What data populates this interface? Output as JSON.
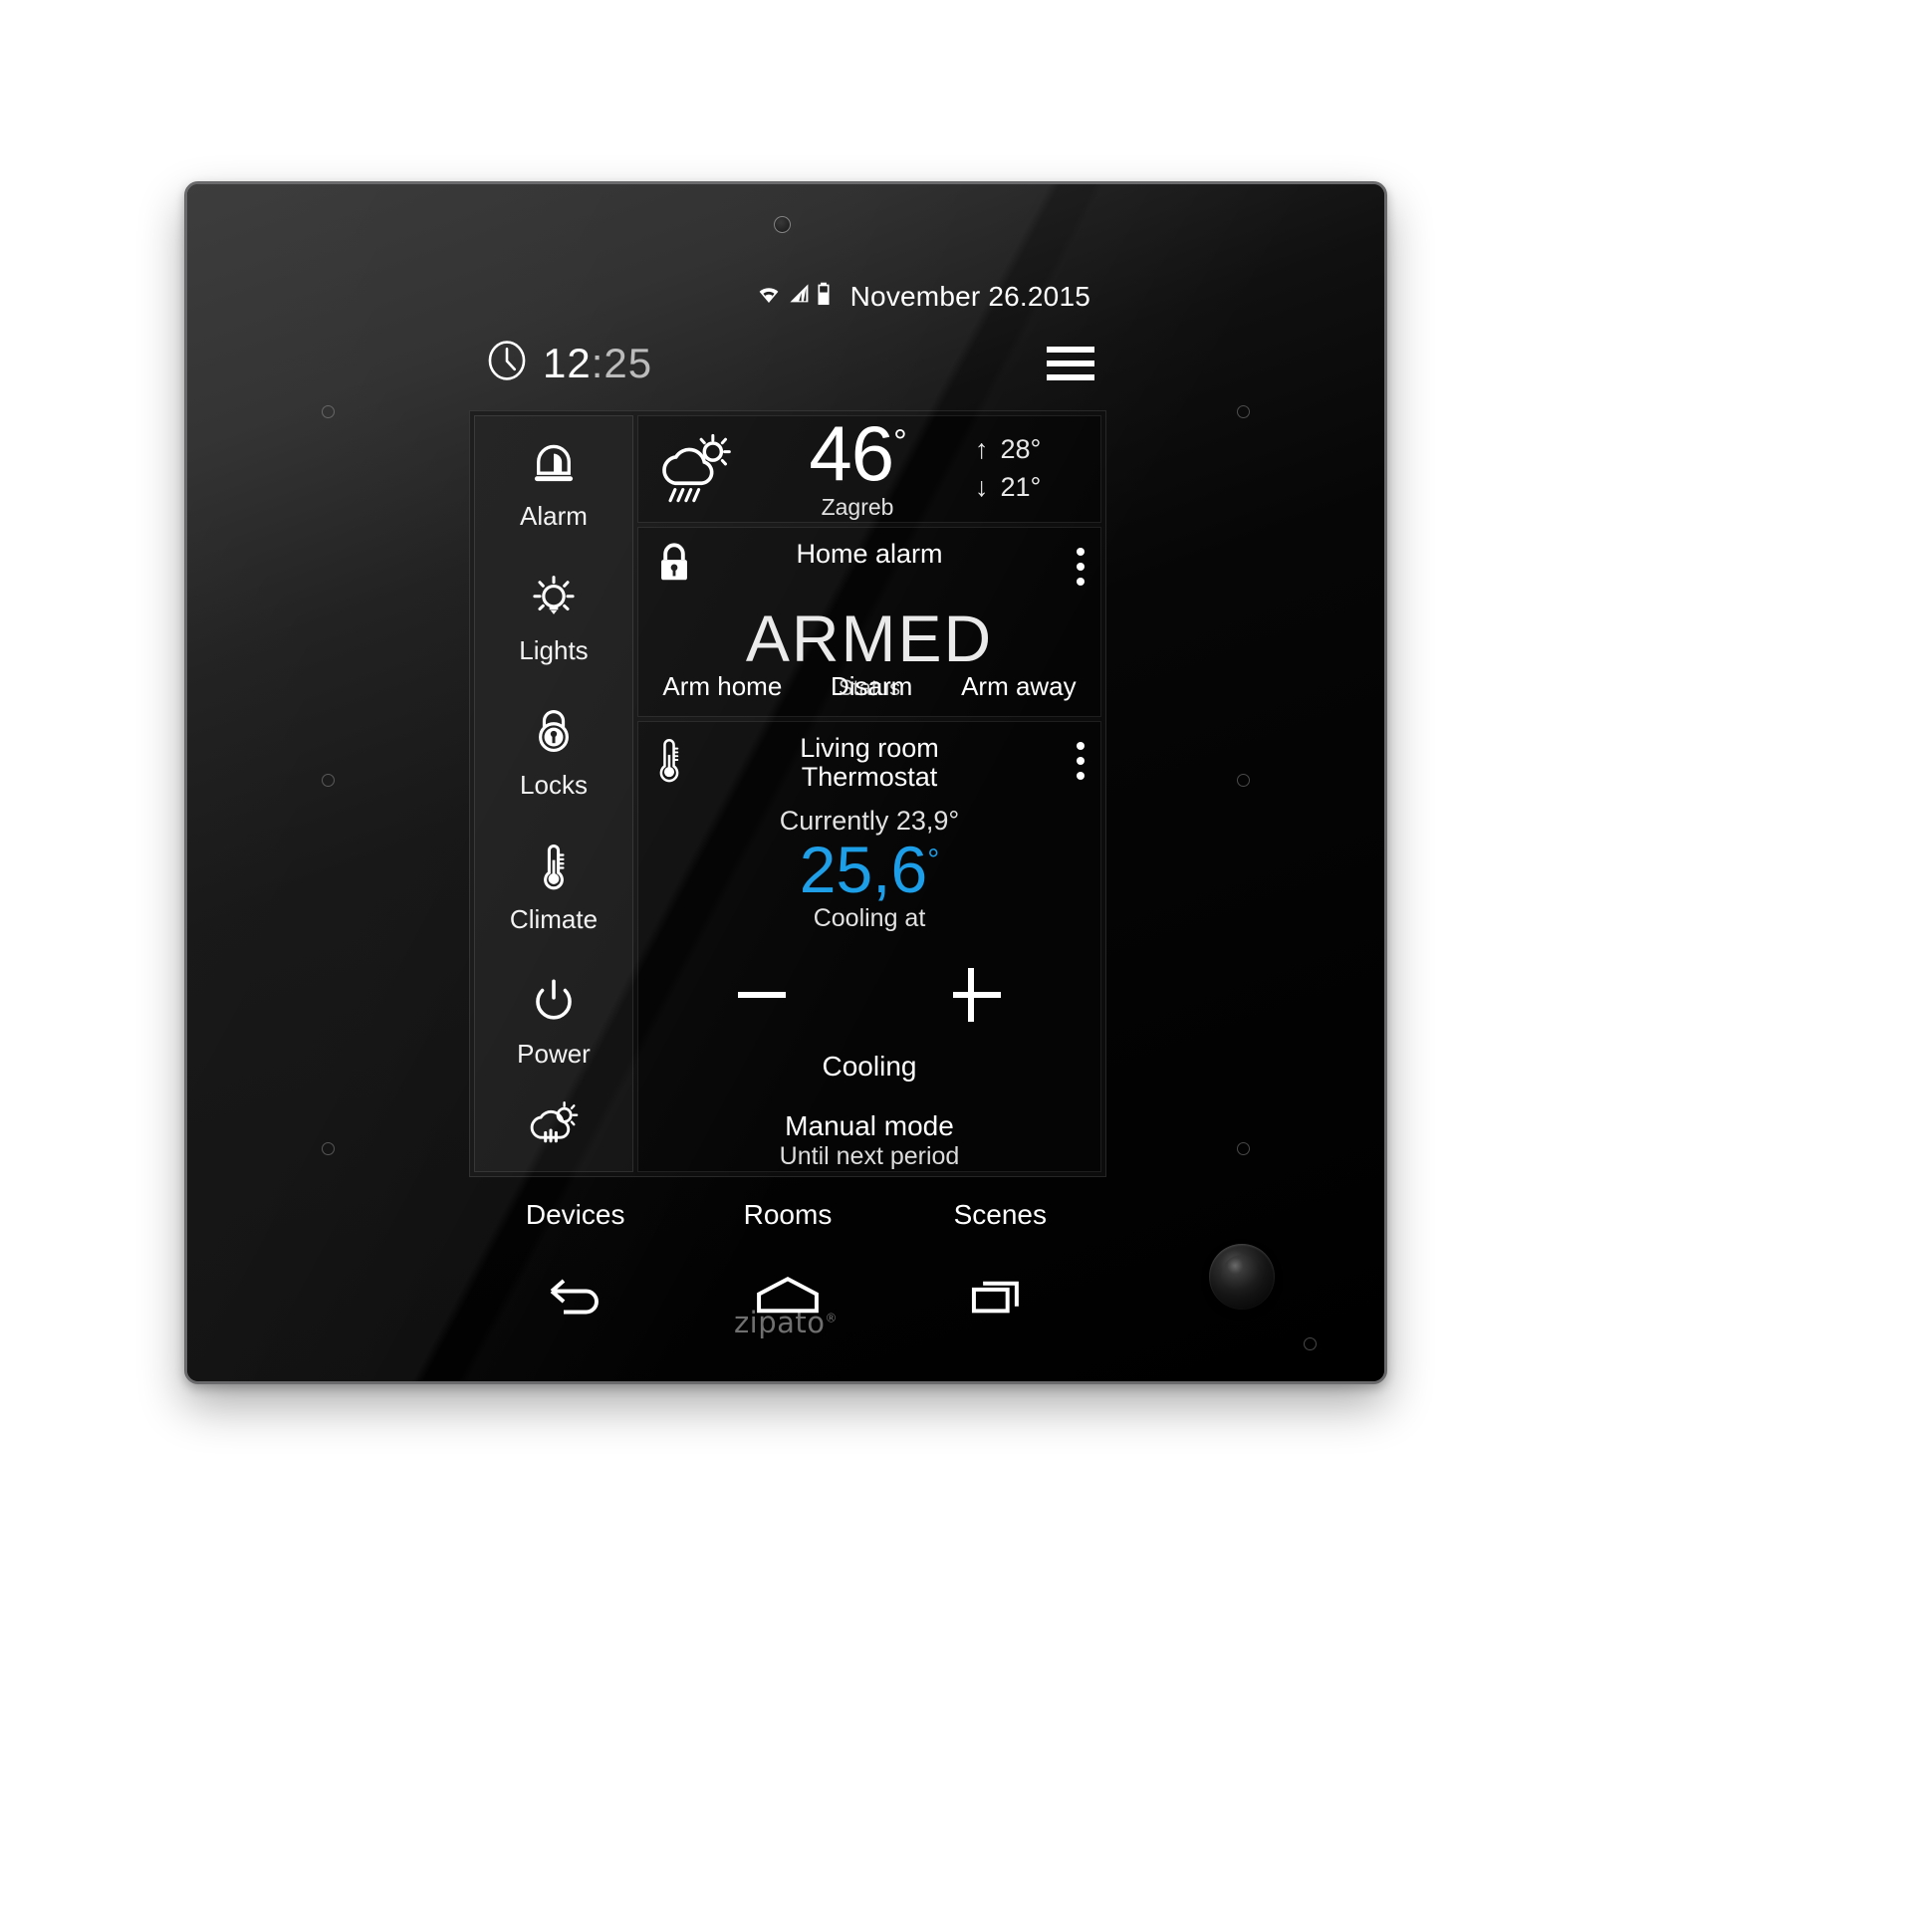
{
  "device": {
    "brand": "zipato",
    "camera_icon": "camera-dot-icon",
    "hardware_button": "home-hardware-button"
  },
  "statusbar": {
    "wifi_icon": "wifi-icon",
    "signal_icon": "cellular-signal-icon",
    "battery_icon": "battery-icon",
    "date": "November 26.2015"
  },
  "header": {
    "clock_icon": "clock-icon",
    "time_hours": "12",
    "time_minutes": ":25",
    "menu_icon": "hamburger-menu-icon"
  },
  "sidebar": {
    "items": [
      {
        "label": "Alarm",
        "icon": "siren-icon"
      },
      {
        "label": "Lights",
        "icon": "lightbulb-icon"
      },
      {
        "label": "Locks",
        "icon": "padlock-round-icon"
      },
      {
        "label": "Climate",
        "icon": "thermometer-icon"
      },
      {
        "label": "Power",
        "icon": "power-icon"
      },
      {
        "label": "",
        "icon": "weather-cloud-sun-rain-icon"
      }
    ]
  },
  "weather_card": {
    "icon": "cloud-sun-rain-icon",
    "temperature": "46",
    "degree": "°",
    "city": "Zagreb",
    "high_arrow": "↑",
    "high": "28°",
    "low_arrow": "↓",
    "low": "21°"
  },
  "alarm_card": {
    "icon": "padlock-closed-icon",
    "title": "Home alarm",
    "menu_icon": "overflow-menu-icon",
    "status_value": "ARMED",
    "status_label": "Status",
    "actions": [
      "Arm home",
      "Disarm",
      "Arm away"
    ]
  },
  "thermostat_card": {
    "icon": "thermometer-icon",
    "title_line1": "Living room",
    "title_line2": "Thermostat",
    "menu_icon": "overflow-menu-icon",
    "current_label": "Currently 23,9°",
    "target_value": "25,6",
    "target_degree": "°",
    "target_color": "#1b9ee8",
    "target_label": "Cooling at",
    "decrease_icon": "minus-icon",
    "increase_icon": "plus-icon",
    "mode": "Cooling",
    "schedule_mode": "Manual mode",
    "schedule_detail": "Until next period"
  },
  "tabbar": {
    "tabs": [
      "Devices",
      "Rooms",
      "Scenes"
    ]
  },
  "navbar": {
    "back_icon": "back-arrow-icon",
    "home_icon": "home-icon",
    "recents_icon": "recent-apps-icon"
  }
}
